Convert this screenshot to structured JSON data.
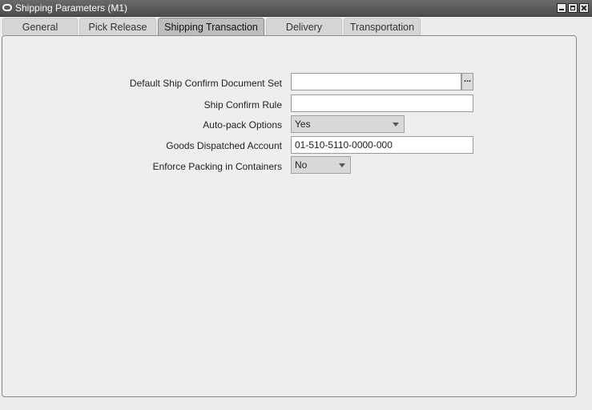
{
  "window": {
    "title": "Shipping Parameters (M1)"
  },
  "tabs": [
    {
      "label": "General"
    },
    {
      "label": "Pick Release"
    },
    {
      "label": "Shipping Transaction"
    },
    {
      "label": "Delivery"
    },
    {
      "label": "Transportation"
    }
  ],
  "active_tab": "Shipping Transaction",
  "form": {
    "doc_set": {
      "label": "Default Ship Confirm Document Set",
      "value": "",
      "lov": "..."
    },
    "confirm_rule": {
      "label": "Ship Confirm Rule",
      "value": ""
    },
    "autopack": {
      "label": "Auto-pack Options",
      "value": "Yes"
    },
    "goods_account": {
      "label": "Goods Dispatched Account",
      "value": "01-510-5110-0000-000"
    },
    "enforce_packing": {
      "label": "Enforce Packing in Containers",
      "value": "No"
    }
  }
}
